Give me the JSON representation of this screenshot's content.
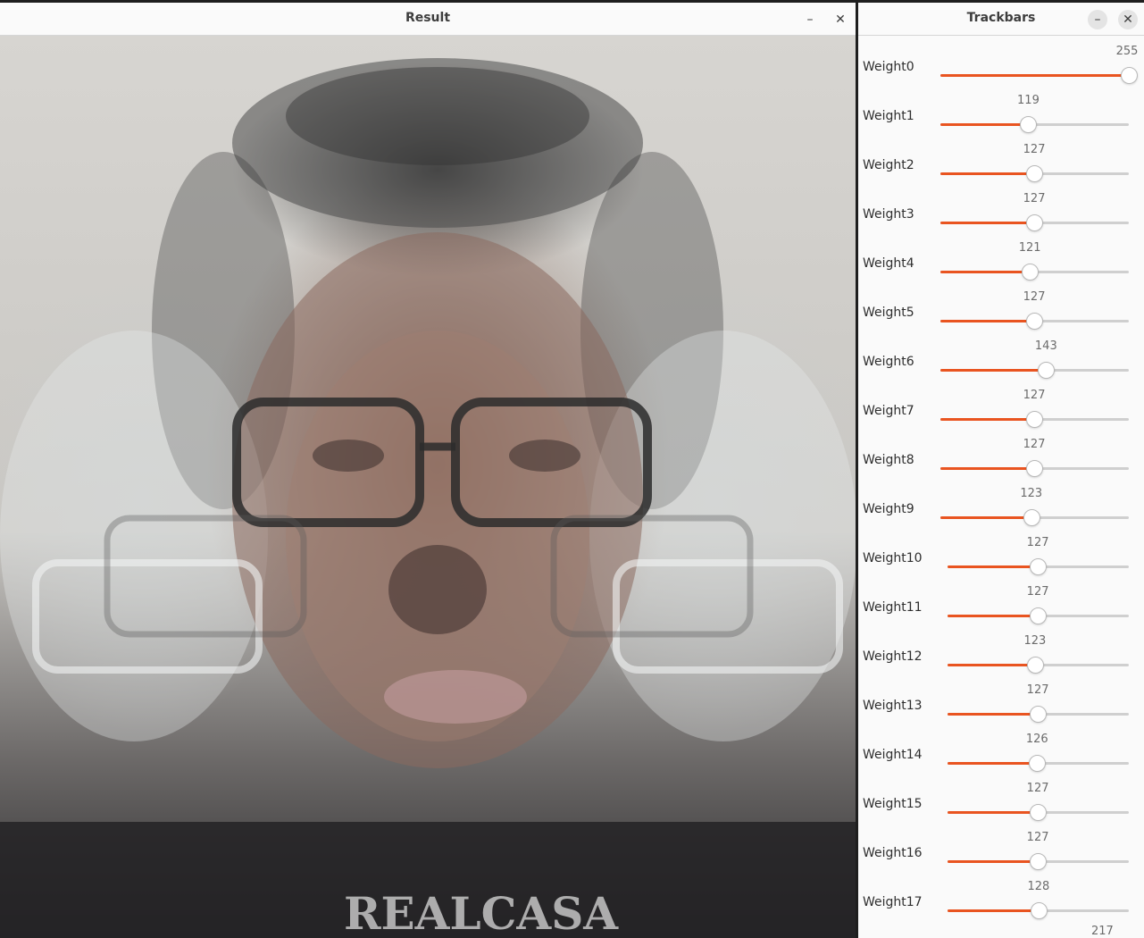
{
  "result_window": {
    "title": "Result",
    "minimize_glyph": "–",
    "close_glyph": "✕"
  },
  "trackbars_window": {
    "title": "Trackbars",
    "minimize_glyph": "–",
    "close_glyph": "✕",
    "max": 255,
    "accent": "#e95420",
    "sliders": [
      {
        "label": "Weight0",
        "value": 255,
        "display": "255"
      },
      {
        "label": "Weight1",
        "value": 119,
        "display": "119"
      },
      {
        "label": "Weight2",
        "value": 127,
        "display": "127"
      },
      {
        "label": "Weight3",
        "value": 127,
        "display": "127"
      },
      {
        "label": "Weight4",
        "value": 121,
        "display": "121"
      },
      {
        "label": "Weight5",
        "value": 127,
        "display": "127"
      },
      {
        "label": "Weight6",
        "value": 143,
        "display": "143"
      },
      {
        "label": "Weight7",
        "value": 127,
        "display": "127"
      },
      {
        "label": "Weight8",
        "value": 127,
        "display": "127"
      },
      {
        "label": "Weight9",
        "value": 123,
        "display": "123"
      },
      {
        "label": "Weight10",
        "value": 127,
        "display": "127"
      },
      {
        "label": "Weight11",
        "value": 127,
        "display": "127"
      },
      {
        "label": "Weight12",
        "value": 123,
        "display": "123"
      },
      {
        "label": "Weight13",
        "value": 127,
        "display": "127"
      },
      {
        "label": "Weight14",
        "value": 126,
        "display": "126"
      },
      {
        "label": "Weight15",
        "value": 127,
        "display": "127"
      },
      {
        "label": "Weight16",
        "value": 127,
        "display": "127"
      },
      {
        "label": "Weight17",
        "value": 128,
        "display": "128"
      }
    ],
    "next_value": "217"
  },
  "image": {
    "shirt_text": "REALCASA"
  }
}
